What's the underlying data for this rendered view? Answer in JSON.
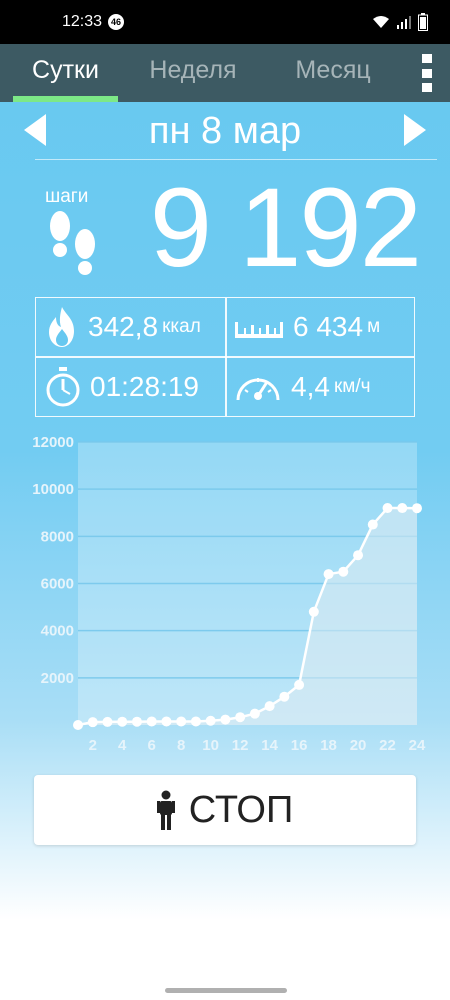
{
  "status_bar": {
    "time": "12:33",
    "badge": "46"
  },
  "tabs": [
    {
      "label": "Сутки",
      "active": true
    },
    {
      "label": "Неделя",
      "active": false
    },
    {
      "label": "Месяц",
      "active": false
    }
  ],
  "date": {
    "label": "пн 8 мар"
  },
  "steps": {
    "label": "шаги",
    "value": "9 192"
  },
  "stats": {
    "calories": {
      "value": "342,8",
      "unit": "ккал",
      "icon": "flame-icon"
    },
    "distance": {
      "value": "6 434",
      "unit": "м",
      "icon": "ruler-icon"
    },
    "duration": {
      "value": "01:28:19",
      "icon": "stopwatch-icon"
    },
    "speed": {
      "value": "4,4",
      "unit": "км/ч",
      "icon": "speedometer-icon"
    }
  },
  "chart_data": {
    "type": "area",
    "x": [
      1,
      2,
      3,
      4,
      5,
      6,
      7,
      8,
      9,
      10,
      11,
      12,
      13,
      14,
      15,
      16,
      17,
      18,
      19,
      20,
      21,
      22,
      23,
      24
    ],
    "values": [
      0,
      120,
      130,
      140,
      140,
      150,
      150,
      150,
      150,
      180,
      230,
      330,
      480,
      800,
      1200,
      1700,
      4800,
      6400,
      6500,
      7200,
      8500,
      9200,
      9200,
      9192
    ],
    "x_ticks": [
      "2",
      "4",
      "6",
      "8",
      "10",
      "12",
      "14",
      "16",
      "18",
      "20",
      "22",
      "24"
    ],
    "y_ticks": [
      "2000",
      "4000",
      "6000",
      "8000",
      "10000",
      "12000"
    ],
    "ylim": [
      0,
      12000
    ],
    "xlim": [
      1,
      24
    ]
  },
  "stop_button": {
    "label": "СТОП",
    "icon": "person-icon"
  },
  "colors": {
    "tab_bar": "#3d5a63",
    "tab_indicator": "#7de887",
    "background": "#66c8f0"
  }
}
